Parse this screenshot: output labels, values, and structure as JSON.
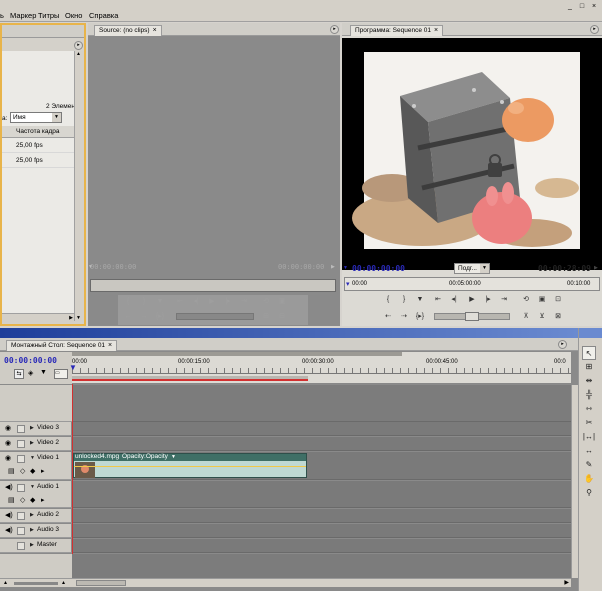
{
  "menu": {
    "items": [
      "ь",
      "Маркер",
      "Титры",
      "Окно",
      "Справка"
    ],
    "window_buttons": [
      "_",
      "□",
      "×"
    ]
  },
  "project_panel": {
    "item_count": "2 Элементы",
    "sort_label": "а:",
    "sort_value": "Имя",
    "column_header": "Частота кадра",
    "rows": [
      "25,00 fps",
      "25,00 fps"
    ]
  },
  "source_panel": {
    "tab": "Source: (no clips)",
    "timecode_left": "00:00:00:00",
    "timecode_right": "00:00:00:00"
  },
  "program_panel": {
    "tab": "Программа: Sequence 01",
    "timecode_current": "00:00:00:00",
    "fit_value": "Подг...",
    "timecode_duration": "00:00:28:09",
    "ruler_start": "00:00",
    "ruler_mid": "00:05:00:00",
    "ruler_end": "00:10:00"
  },
  "timeline_panel": {
    "tab": "Монтажный Стол: Sequence 01",
    "timecode": "00:00:00:00",
    "ruler": [
      "00:00",
      "00:00:15:00",
      "00:00:30:00",
      "00:00:45:00",
      "00:0"
    ],
    "tracks": {
      "video3": "Video 3",
      "video2": "Video 2",
      "video1": "Video 1",
      "audio1": "Audio 1",
      "audio2": "Audio 2",
      "audio3": "Audio 3",
      "master": "Master"
    },
    "clip_name": "unlocked4.mpg",
    "clip_effect": "Opacity:Opacity"
  },
  "colors": {
    "timecode_blue": "#2a2ab8",
    "selection_orange": "#e8b44a",
    "playhead_red": "#d23030",
    "clip_teal": "#3f6f66",
    "clip_body": "#bfd9d3"
  },
  "icons": [
    "close-icon",
    "panel-menu-icon",
    "play-icon",
    "step-back-icon",
    "step-forward-icon",
    "mark-in-icon",
    "mark-out-icon",
    "loop-icon",
    "safe-margins-icon",
    "lift-icon",
    "extract-icon",
    "export-frame-icon",
    "eye-icon",
    "speaker-icon",
    "selection-tool-icon",
    "track-select-icon",
    "ripple-edit-icon",
    "razor-icon",
    "slip-icon",
    "pen-icon",
    "hand-icon",
    "zoom-icon"
  ]
}
